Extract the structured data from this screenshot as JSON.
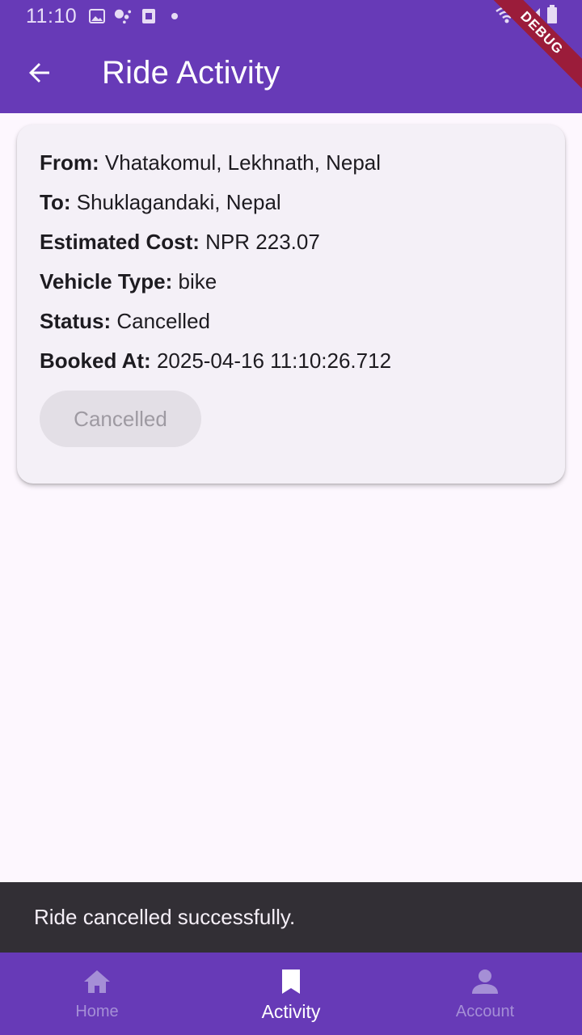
{
  "status_bar": {
    "time": "11:10"
  },
  "app_bar": {
    "title": "Ride Activity"
  },
  "debug_banner": "DEBUG",
  "ride": {
    "from_label": "From:",
    "from_value": "Vhatakomul, Lekhnath, Nepal",
    "to_label": "To:",
    "to_value": "Shuklagandaki, Nepal",
    "cost_label": "Estimated Cost:",
    "cost_value": "NPR 223.07",
    "vehicle_label": "Vehicle Type:",
    "vehicle_value": "bike",
    "status_label": "Status:",
    "status_value": "Cancelled",
    "booked_label": "Booked At:",
    "booked_value": "2025-04-16 11:10:26.712",
    "button_label": "Cancelled"
  },
  "snackbar": {
    "message": "Ride cancelled successfully."
  },
  "bottom_nav": {
    "items": [
      {
        "label": "Home",
        "icon": "home-icon",
        "active": false
      },
      {
        "label": "Activity",
        "icon": "bookmark-icon",
        "active": true
      },
      {
        "label": "Account",
        "icon": "person-icon",
        "active": false
      }
    ]
  },
  "colors": {
    "primary": "#673ab7",
    "card_bg": "#f4f0f7",
    "page_bg": "#fdf7fe",
    "snackbar_bg": "#322f35",
    "debug_ribbon": "#9b1c3a"
  }
}
